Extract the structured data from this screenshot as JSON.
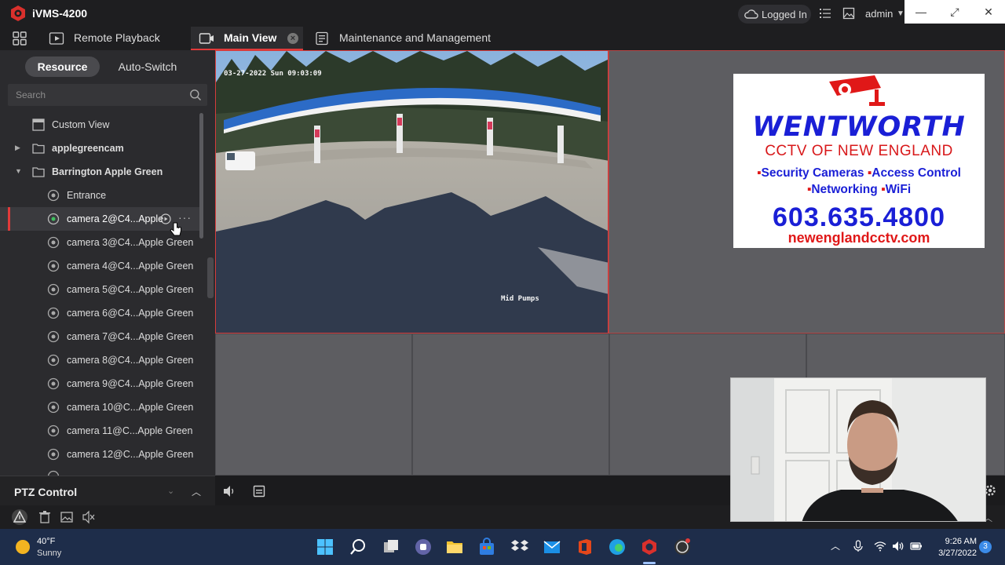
{
  "app": {
    "title": "iVMS-4200",
    "login_status": "Logged In",
    "user": "admin"
  },
  "tabs": [
    {
      "label": "Remote Playback"
    },
    {
      "label": "Main View"
    },
    {
      "label": "Maintenance and Management"
    }
  ],
  "sidebar": {
    "segments": [
      "Resource",
      "Auto-Switch"
    ],
    "search_placeholder": "Search",
    "tree": [
      {
        "label": "Custom View",
        "icon": "custom-view-icon"
      },
      {
        "label": "applegreencam",
        "icon": "folder-icon"
      },
      {
        "label": "Barrington Apple Green",
        "icon": "folder-icon"
      },
      {
        "label": "Entrance",
        "icon": "camera-icon"
      },
      {
        "label": "camera 2@C4...Apple",
        "icon": "camera-icon"
      },
      {
        "label": "camera 3@C4...Apple Green",
        "icon": "camera-icon"
      },
      {
        "label": "camera 4@C4...Apple Green",
        "icon": "camera-icon"
      },
      {
        "label": "camera 5@C4...Apple Green",
        "icon": "camera-icon"
      },
      {
        "label": "camera 6@C4...Apple Green",
        "icon": "camera-icon"
      },
      {
        "label": "camera 7@C4...Apple Green",
        "icon": "camera-icon"
      },
      {
        "label": "camera 8@C4...Apple Green",
        "icon": "camera-icon"
      },
      {
        "label": "camera 9@C4...Apple Green",
        "icon": "camera-icon"
      },
      {
        "label": "camera 10@C...Apple Green",
        "icon": "camera-icon"
      },
      {
        "label": "camera 11@C...Apple Green",
        "icon": "camera-icon"
      },
      {
        "label": "camera 12@C...Apple Green",
        "icon": "camera-icon"
      }
    ],
    "ptz_label": "PTZ Control"
  },
  "video": {
    "timestamp": "03-27-2022 Sun 09:03:09",
    "camera_name": "Mid Pumps"
  },
  "overlay_ad": {
    "brand": "WENTWORTH",
    "subtitle": "CCTV OF NEW ENGLAND",
    "line1_a": "Security Cameras",
    "line1_b": "Access Control",
    "line2_a": "Networking",
    "line2_b": "WiFi",
    "phone": "603.635.4800",
    "website": "newenglandcctv.com"
  },
  "taskbar": {
    "temperature": "40°F",
    "condition": "Sunny",
    "time": "9:26 AM",
    "date": "3/27/2022",
    "notifications": "3"
  },
  "colors": {
    "accent_red": "#e13a3a",
    "ad_blue": "#1a1fd6",
    "ad_red": "#e01818"
  }
}
